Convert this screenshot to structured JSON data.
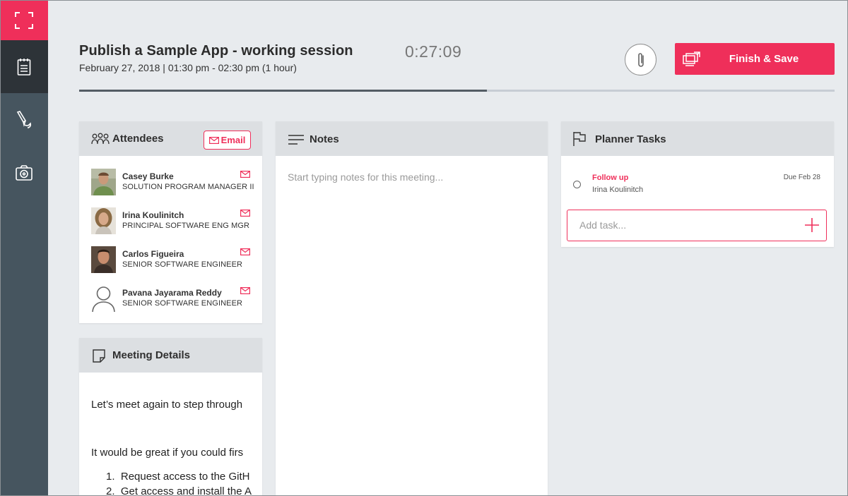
{
  "meeting": {
    "title": "Publish a Sample App - working session",
    "datetime": "February 27, 2018 | 01:30 pm - 02:30 pm (1 hour)",
    "timer": "0:27:09",
    "progress_percent": 54
  },
  "toolbar": {
    "finish_label": "Finish & Save",
    "attach_icon": "paperclip-icon",
    "finish_icon": "save-screen-icon"
  },
  "sidebar": {
    "items": [
      {
        "icon": "fullscreen-icon",
        "active": false
      },
      {
        "icon": "notepad-icon",
        "active": true
      },
      {
        "icon": "pen-ink-icon",
        "active": false
      },
      {
        "icon": "camera-icon",
        "active": false
      }
    ]
  },
  "attendees": {
    "title": "Attendees",
    "email_label": "Email",
    "people": [
      {
        "name": "Casey Burke",
        "role": "SOLUTION PROGRAM MANAGER II"
      },
      {
        "name": "Irina Koulinitch",
        "role": "PRINCIPAL SOFTWARE ENG MGR"
      },
      {
        "name": "Carlos Figueira",
        "role": "SENIOR SOFTWARE ENGINEER"
      },
      {
        "name": "Pavana Jayarama Reddy",
        "role": "SENIOR SOFTWARE ENGINEER"
      }
    ]
  },
  "details": {
    "title": "Meeting Details",
    "paragraph1": "Let’s meet again to step through",
    "paragraph2": "It would be great if you could firs",
    "list": [
      {
        "num": "1.",
        "text": "Request access to the GitH"
      },
      {
        "num": "2.",
        "text": "Get access and install the A"
      }
    ]
  },
  "notes": {
    "title": "Notes",
    "placeholder": "Start typing notes for this meeting..."
  },
  "planner": {
    "title": "Planner Tasks",
    "tasks": [
      {
        "title": "Follow up",
        "assignee": "Irina Koulinitch",
        "due": "Due Feb 28"
      }
    ],
    "add_placeholder": "Add task..."
  },
  "colors": {
    "accent": "#ef2f5a",
    "sidebar": "#46555f",
    "sidebar_active": "#2d3338",
    "background": "#e8ebee",
    "panel_header": "#dcdfe2"
  }
}
